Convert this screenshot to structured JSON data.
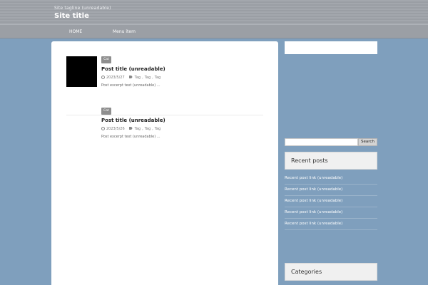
{
  "header": {
    "description": "Site tagline (unreadable)",
    "title": "Site title"
  },
  "nav": {
    "home": "HOME",
    "item2": "Menu item"
  },
  "entries": [
    {
      "category": "Cat",
      "title": "Post title (unreadable)",
      "date": "2023/5/27",
      "tags": [
        "Tag",
        "Tag",
        "Tag"
      ],
      "excerpt": "Post excerpt text (unreadable) ..."
    },
    {
      "category": "Cat",
      "title": "Post title (unreadable)",
      "date": "2023/5/26",
      "tags": [
        "Tag",
        "Tag",
        "Tag"
      ],
      "excerpt": "Post excerpt text (unreadable) ..."
    }
  ],
  "sidebar": {
    "search": {
      "placeholder": "",
      "button_label": "Search"
    },
    "recent": {
      "title": "Recent posts",
      "items": [
        "Recent post link (unreadable)",
        "Recent post link (unreadable)",
        "Recent post link (unreadable)",
        "Recent post link (unreadable)",
        "Recent post link (unreadable)"
      ]
    },
    "categories": {
      "title": "Categories"
    }
  },
  "colors": {
    "background": "#7f9fbd",
    "header": "#a3a7ad",
    "nav": "#9b9fa5",
    "panel": "#ffffff",
    "badge": "#8e8e8e"
  }
}
